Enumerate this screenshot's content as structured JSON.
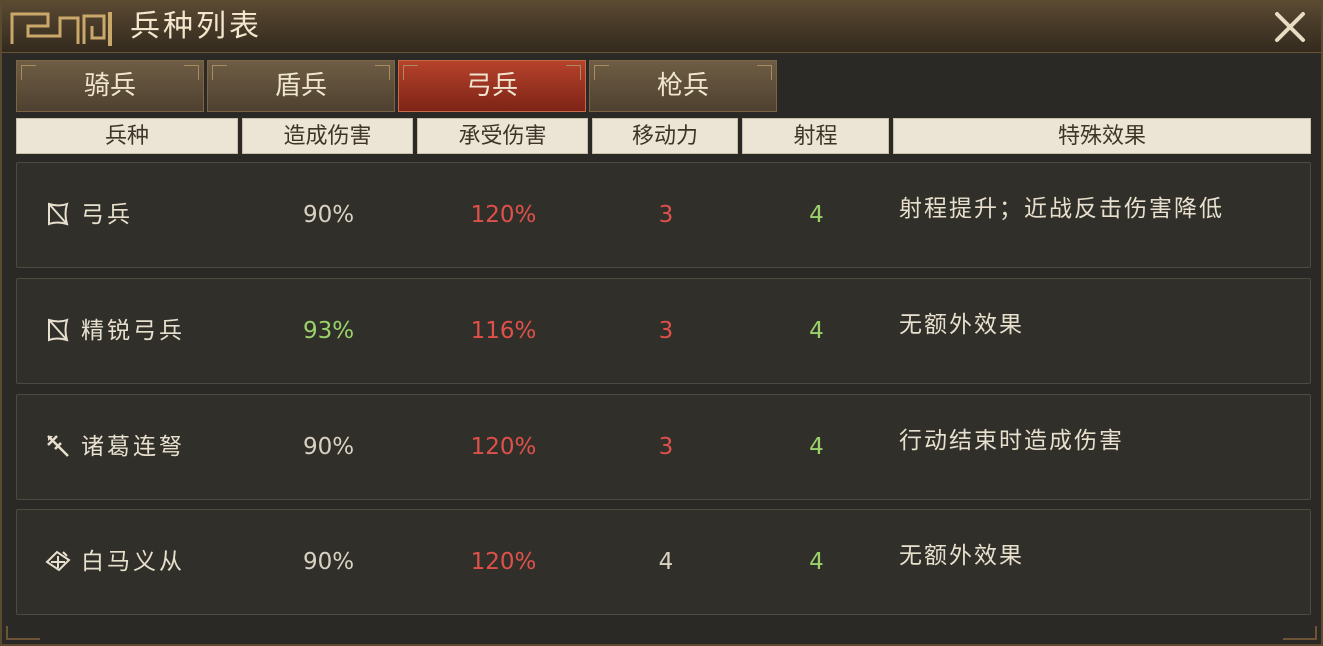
{
  "window": {
    "title": "兵种列表"
  },
  "tabs": [
    {
      "label": "骑兵",
      "active": false
    },
    {
      "label": "盾兵",
      "active": false
    },
    {
      "label": "弓兵",
      "active": true
    },
    {
      "label": "枪兵",
      "active": false
    }
  ],
  "columns": [
    "兵种",
    "造成伤害",
    "承受伤害",
    "移动力",
    "射程",
    "特殊效果"
  ],
  "colors": {
    "neutral": "#d9d2c2",
    "good": "#9ad26a",
    "bad": "#e0504a",
    "active_tab": "#b6422b"
  },
  "rows": [
    {
      "icon": "bow-icon",
      "name": "弓兵",
      "dmg_dealt": "90%",
      "dmg_taken": "120%",
      "move": "3",
      "range": "4",
      "effect": "射程提升；近战反击伤害降低",
      "dmg_dealt_color": "neutral",
      "dmg_taken_color": "bad",
      "move_color": "bad",
      "range_color": "good"
    },
    {
      "icon": "bow-icon",
      "name": "精锐弓兵",
      "dmg_dealt": "93%",
      "dmg_taken": "116%",
      "move": "3",
      "range": "4",
      "effect": "无额外效果",
      "dmg_dealt_color": "good",
      "dmg_taken_color": "bad",
      "move_color": "bad",
      "range_color": "good"
    },
    {
      "icon": "crossbow-icon",
      "name": "诸葛连弩",
      "dmg_dealt": "90%",
      "dmg_taken": "120%",
      "move": "3",
      "range": "4",
      "effect": "行动结束时造成伤害",
      "dmg_dealt_color": "neutral",
      "dmg_taken_color": "bad",
      "move_color": "bad",
      "range_color": "good"
    },
    {
      "icon": "horse-archer-icon",
      "name": "白马义从",
      "dmg_dealt": "90%",
      "dmg_taken": "120%",
      "move": "4",
      "range": "4",
      "effect": "无额外效果",
      "dmg_dealt_color": "neutral",
      "dmg_taken_color": "bad",
      "move_color": "neutral",
      "range_color": "good"
    }
  ]
}
